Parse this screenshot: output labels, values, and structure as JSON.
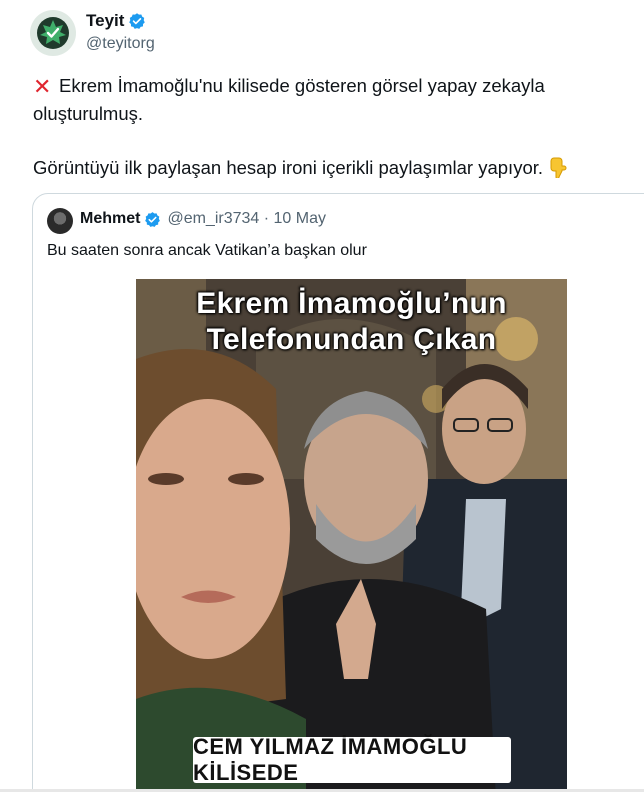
{
  "author": {
    "name": "Teyit",
    "handle": "@teyitorg",
    "avatar_icon": "teyit-logo-icon",
    "verified_icon": "verified-badge-icon"
  },
  "tweet": {
    "line1": "Ekrem İmamoğlu'nu kilisede gösteren görsel yapay zekayla oluşturulmuş.",
    "line2": "Görüntüyü ilk paylaşan hesap ironi içerikli paylaşımlar yapıyor.",
    "x_icon": "red-x-icon",
    "point_icon": "backhand-index-pointing-down-icon"
  },
  "quoted": {
    "name": "Mehmet",
    "meta": "@em_ir3734 · 10 May",
    "text": "Bu saaten sonra ancak Vatikan’a başkan olur",
    "image": {
      "caption_top_1": "Ekrem İmamoğlu’nun",
      "caption_top_2": "Telefonundan Çıkan",
      "caption_bottom": "CEM YILMAZ İMAMOĞLU KİLİSEDE"
    }
  },
  "colors": {
    "text": "#0f1419",
    "secondary": "#536471",
    "verified": "#1d9bf0",
    "border": "#cfd9de",
    "x_red": "#e0262f"
  }
}
